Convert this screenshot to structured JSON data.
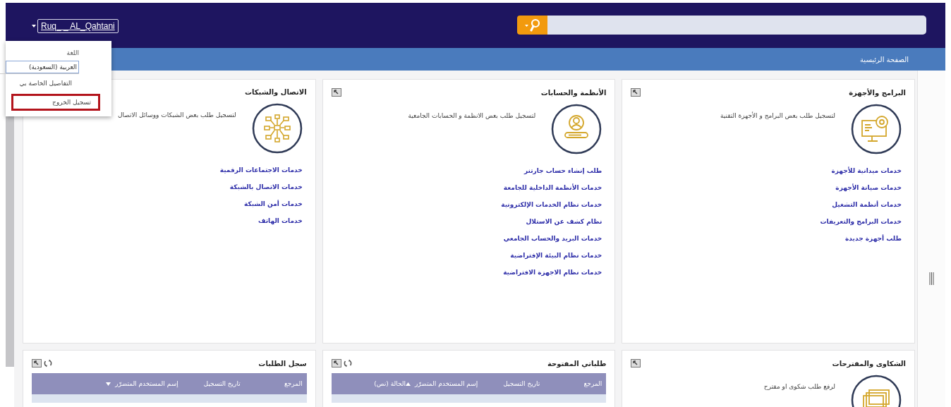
{
  "header": {
    "user_name": "Ruq_ _ AL_Qahtani"
  },
  "breadcrumb": "الصفحة الرئيسية",
  "user_menu": {
    "language_label": "اللغة",
    "language_value": "العربية (السعودية)",
    "items": [
      {
        "label": "التفاصيل الخاصة بي",
        "highlighted": false
      },
      {
        "label": "تسجيل الخروج",
        "highlighted": true
      }
    ]
  },
  "service_cards": [
    {
      "title": "البرامج والأجهزة",
      "description": "لتسجيل طلب بعض البرامج و الأجهزة التقنية",
      "expand_button": true,
      "links": [
        "خدمات ميدانية للأجهزة",
        "خدمات صيانة الأجهزة",
        "خدمات أنظمة التشغيل",
        "خدمات البرامج والتعريفات",
        "طلب أجهزة جديدة"
      ]
    },
    {
      "title": "الأنظمة والحسابات",
      "description": "لتسجيل طلب بعض الانظمة و الحسابات الجامعية",
      "expand_button": true,
      "links": [
        "طلب إنشاء حساب جارتنر",
        "خدمات الأنظمة الداخلية للجامعة",
        "خدمات نظام الخدمات الإلكترونية",
        "نظام كشف عن الاستلال",
        "خدمات البريد والحساب الجامعي",
        "خدمات نظام البيئة الإفتراضية",
        "خدمات نظام الاجهزة الافتراضية"
      ]
    },
    {
      "title": "الاتصال والشبكات",
      "description": "لتسجيل طلب بعض الشبكات ووسائل الاتصال",
      "expand_button": false,
      "links": [
        "خدمات الاجتماعات الرقمية",
        "خدمات الاتصال بالشبكة",
        "خدمات أمن الشبكة",
        "خدمات الهاتف"
      ]
    }
  ],
  "bottom_cards": [
    {
      "kind": "service",
      "title": "الشكاوى والمقترحات",
      "description": "لرفع طلب شكوى او مقترح"
    },
    {
      "kind": "table",
      "title": "طلباتي المفتوحة",
      "columns": [
        {
          "label": "المرجع",
          "sorted": false
        },
        {
          "label": "تاريخ التسجيل",
          "sorted": false
        },
        {
          "label": "إسم المستخدم المتضرّر",
          "sorted": true,
          "ascending": true
        },
        {
          "label": "الحالة (نص)",
          "sorted": false
        }
      ]
    },
    {
      "kind": "table",
      "title": "سجل الطلبات",
      "columns": [
        {
          "label": "المرجع",
          "sorted": false
        },
        {
          "label": "تاريخ التسجيل",
          "sorted": false
        },
        {
          "label": "إسم المستخدم المتضرّر",
          "sorted": true,
          "ascending": false
        }
      ]
    }
  ]
}
